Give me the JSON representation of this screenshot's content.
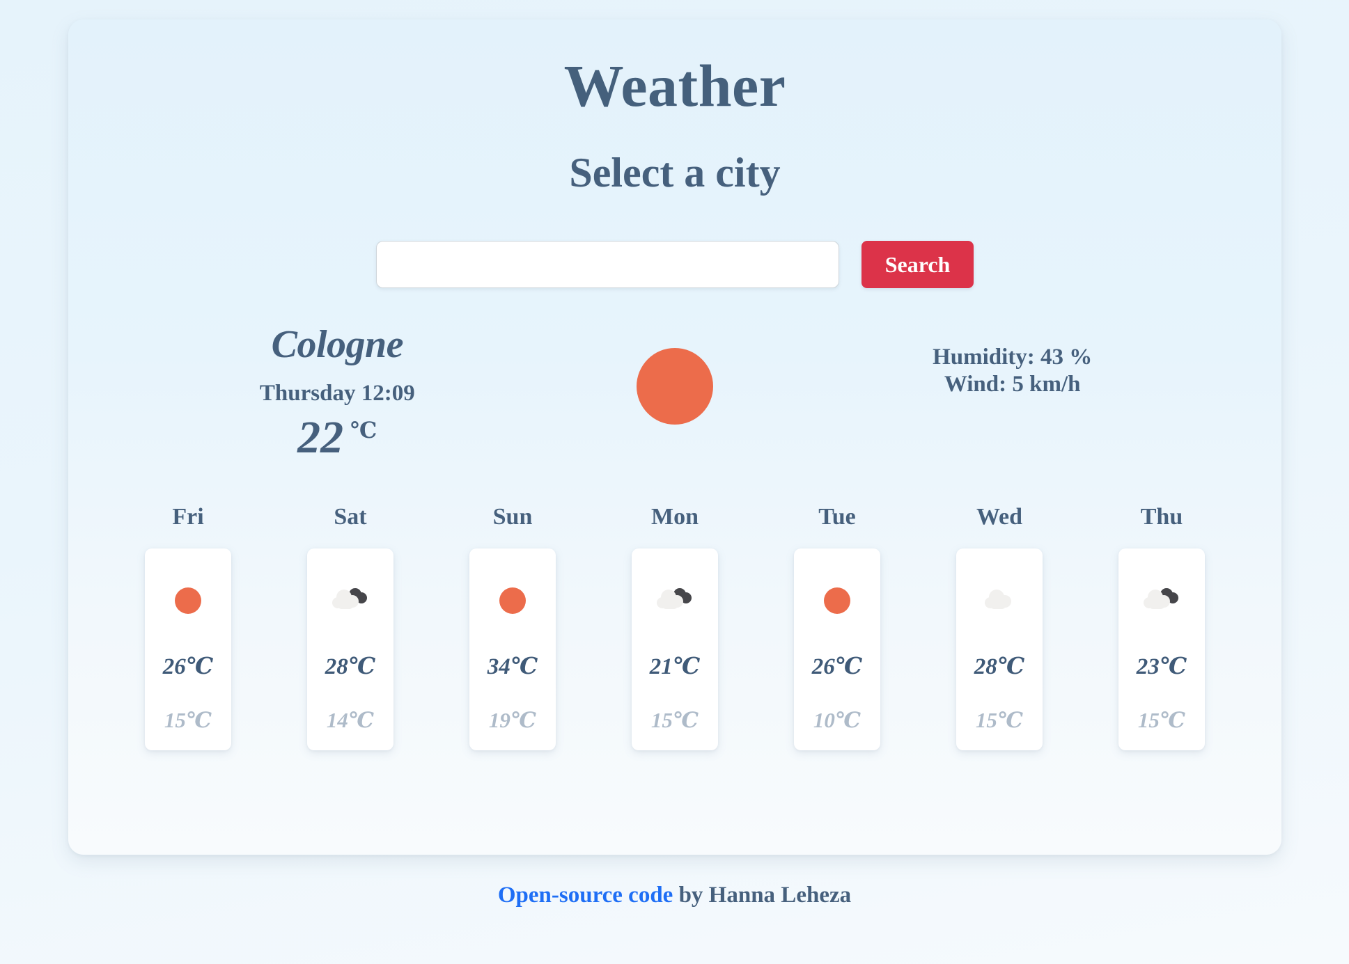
{
  "app": {
    "title": "Weather",
    "subtitle": "Select a city"
  },
  "search": {
    "value": "",
    "placeholder": "",
    "button_label": "Search"
  },
  "current": {
    "city": "Cologne",
    "datetime": "Thursday 12:09",
    "temperature": "22",
    "unit": "℃",
    "icon": "sun-icon",
    "humidity": "Humidity: 43 %",
    "wind": "Wind: 5 km/h"
  },
  "forecast": [
    {
      "day": "Fri",
      "icon": "sun-icon",
      "max": "26℃",
      "min": "15℃"
    },
    {
      "day": "Sat",
      "icon": "clouds-icon",
      "max": "28℃",
      "min": "14℃"
    },
    {
      "day": "Sun",
      "icon": "sun-icon",
      "max": "34℃",
      "min": "19℃"
    },
    {
      "day": "Mon",
      "icon": "clouds-icon",
      "max": "21℃",
      "min": "15℃"
    },
    {
      "day": "Tue",
      "icon": "sun-icon",
      "max": "26℃",
      "min": "10℃"
    },
    {
      "day": "Wed",
      "icon": "cloud-icon",
      "max": "28℃",
      "min": "15℃"
    },
    {
      "day": "Thu",
      "icon": "clouds-icon",
      "max": "23℃",
      "min": "15℃"
    }
  ],
  "footer": {
    "link_label": "Open-source code",
    "credit": " by Hanna Leheza"
  },
  "colors": {
    "accent_red": "#dc3349",
    "sun_orange": "#ec6c4b",
    "text_slate": "#46607d",
    "muted_slate": "#aebbc9",
    "link_blue": "#1e6ef5",
    "cloud_light": "#f1f0ee",
    "cloud_dark": "#46464a",
    "background": "#e3f2fb"
  }
}
